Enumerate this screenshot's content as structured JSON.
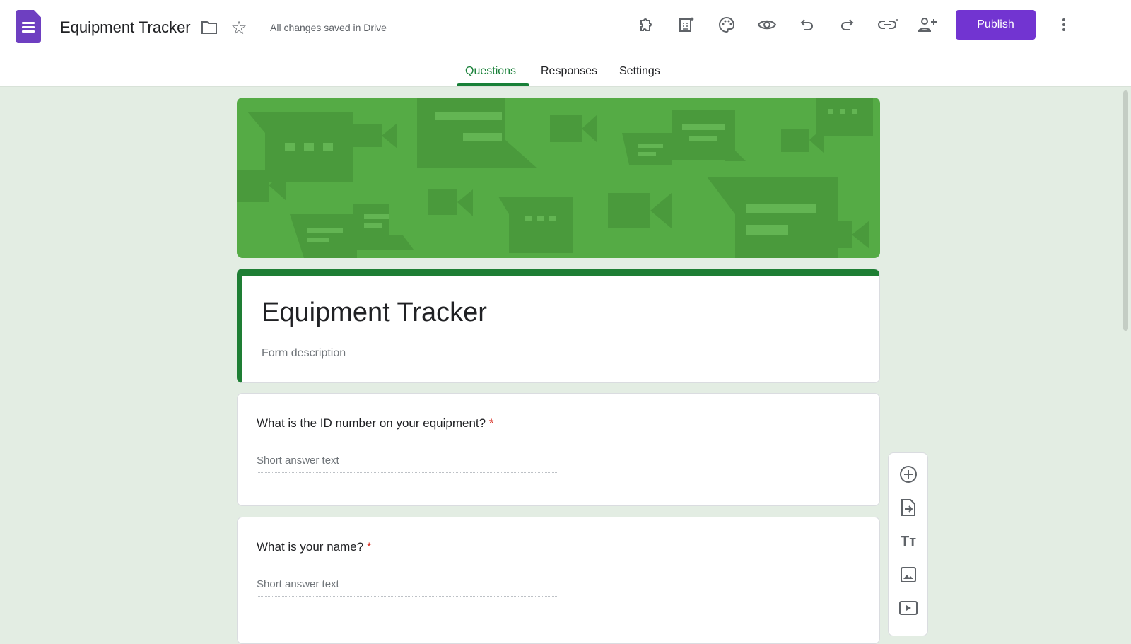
{
  "header": {
    "doc_title": "Equipment Tracker",
    "save_status": "All changes saved in Drive",
    "publish_label": "Publish"
  },
  "tabs": [
    {
      "label": "Questions",
      "active": true
    },
    {
      "label": "Responses"
    },
    {
      "label": "Settings"
    }
  ],
  "form": {
    "title": "Equipment Tracker",
    "description_placeholder": "Form description"
  },
  "questions": [
    {
      "text": "What is the ID number on your equipment?",
      "required_mark": "*",
      "answer_placeholder": "Short answer text"
    },
    {
      "text": "What is your name?",
      "required_mark": "*",
      "answer_placeholder": "Short answer text"
    }
  ],
  "colors": {
    "accent": "#7234d1",
    "theme": "#188038",
    "background": "#e3ede3"
  }
}
